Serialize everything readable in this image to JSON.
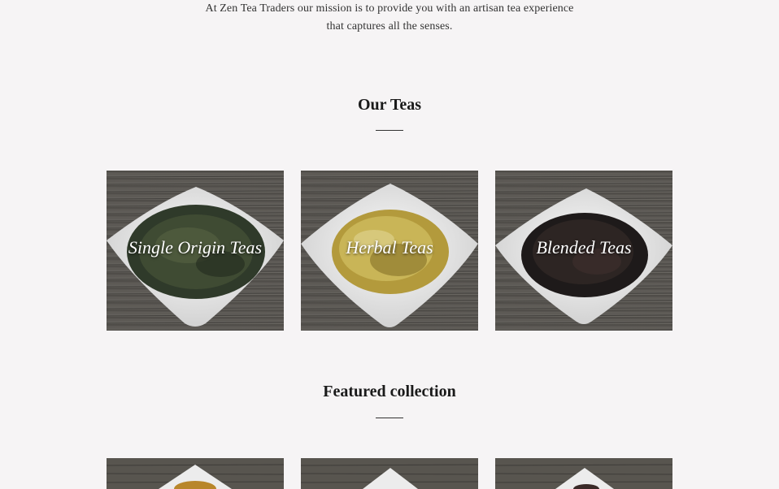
{
  "mission": {
    "line1": "At Zen Tea Traders our mission is to provide you with an artisan tea experience",
    "line2": "that captures all the senses."
  },
  "our_teas": {
    "title": "Our Teas",
    "cards": [
      {
        "label": "Single Origin Teas"
      },
      {
        "label": "Herbal Teas"
      },
      {
        "label": "Blended Teas"
      }
    ]
  },
  "featured": {
    "title": "Featured collection"
  },
  "colors": {
    "background": "#f6f4f5",
    "wood": "#5e5b56",
    "plate": "#eeeeee"
  }
}
